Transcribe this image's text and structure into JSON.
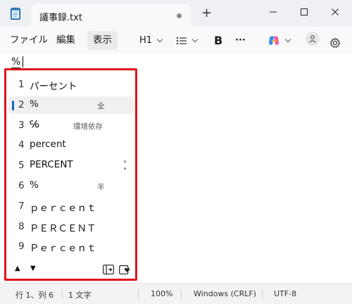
{
  "window": {
    "tab_title": "議事録.txt",
    "new_tab_label": "+"
  },
  "menu": {
    "file": "ファイル",
    "edit": "編集",
    "view": "表示"
  },
  "toolbar": {
    "heading": "H1",
    "bold": "B",
    "more": "···"
  },
  "editor": {
    "typed_text": "%"
  },
  "ime": {
    "selected_index": 2,
    "candidates": [
      {
        "num": "1",
        "text": "パーセント",
        "note": ""
      },
      {
        "num": "2",
        "text": "%",
        "note": "全"
      },
      {
        "num": "3",
        "text": "℅",
        "note": "環境依存"
      },
      {
        "num": "4",
        "text": "percent",
        "note": ""
      },
      {
        "num": "5",
        "text": "PERCENT",
        "note": ""
      },
      {
        "num": "6",
        "text": "%",
        "note": "半"
      },
      {
        "num": "7",
        "text": "ｐｅｒｃｅｎｔ",
        "note": ""
      },
      {
        "num": "8",
        "text": "ＰＥＲＣＥＮＴ",
        "note": ""
      },
      {
        "num": "9",
        "text": "Ｐｅｒｃｅｎｔ",
        "note": ""
      }
    ],
    "up_arrow": "▲",
    "down_arrow": "▼"
  },
  "status": {
    "position": "行 1、列 6",
    "chars": "1 文字",
    "zoom": "100%",
    "line_ending": "Windows (CRLF)",
    "encoding": "UTF-8"
  },
  "colors": {
    "highlight_border": "#e0131e",
    "selection_bar": "#1565c0"
  }
}
